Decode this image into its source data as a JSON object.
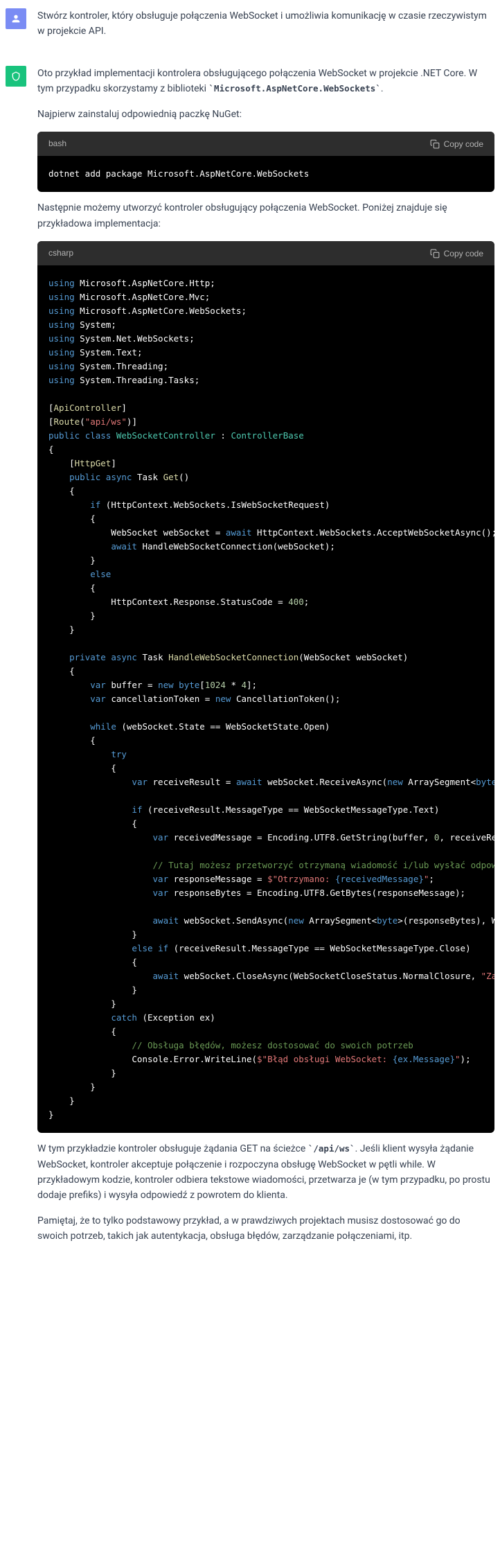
{
  "user_message": "Stwórz kontroler, który obsługuje połączenia WebSocket i umożliwia komunikację w czasie rzeczywistym w projekcie API.",
  "assistant": {
    "intro_pre": "Oto przykład implementacji kontrolera obsługującego połączenia WebSocket w projekcie .NET Core. W tym przypadku skorzystamy z biblioteki ",
    "intro_code": "`Microsoft.AspNetCore.WebSockets`",
    "intro_post": ".",
    "p1": "Najpierw zainstaluj odpowiednią paczkę NuGet:",
    "code1_lang": "bash",
    "code1": "dotnet add package Microsoft.AspNetCore.WebSockets",
    "p2": "Następnie możemy utworzyć kontroler obsługujący połączenia WebSocket. Poniżej znajduje się przykładowa implementacja:",
    "code2_lang": "csharp",
    "p3_pre": "W tym przykładzie kontroler obsługuje żądania GET na ścieżce ",
    "p3_code": "`/api/ws`",
    "p3_post": ". Jeśli klient wysyła żądanie WebSocket, kontroler akceptuje połączenie i rozpoczyna obsługę WebSocket w pętli while. W przykładowym kodzie, kontroler odbiera tekstowe wiadomości, przetwarza je (w tym przypadku, po prostu dodaje prefiks) i wysyła odpowiedź z powrotem do klienta.",
    "p4": "Pamiętaj, że to tylko podstawowy przykład, a w prawdziwych projektach musisz dostosować go do swoich potrzeb, takich jak autentykacja, obsługa błędów, zarządzanie połączeniami, itp."
  },
  "copy_label": "Copy code"
}
